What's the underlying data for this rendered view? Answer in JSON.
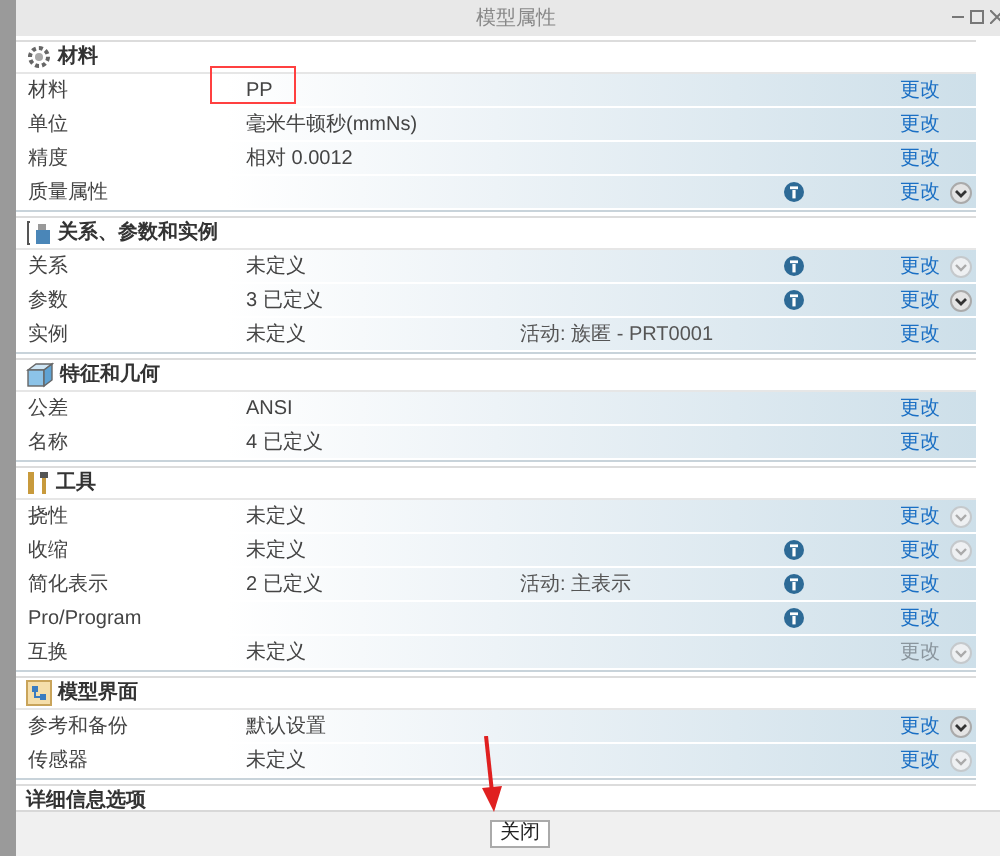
{
  "window": {
    "title": "模型属性"
  },
  "sections": [
    {
      "kind": "material",
      "title": "材料",
      "rows": [
        {
          "label": "材料",
          "value": "PP",
          "highlighted": true,
          "info": false,
          "change": {
            "label": "更改",
            "disabled": false
          }
        },
        {
          "label": "单位",
          "value": "毫米牛顿秒(mmNs)",
          "highlighted": false,
          "info": false,
          "change": {
            "label": "更改",
            "disabled": false
          }
        },
        {
          "label": "精度",
          "value": "相对 0.0012",
          "highlighted": false,
          "info": false,
          "change": {
            "label": "更改",
            "disabled": false
          }
        },
        {
          "label": "质量属性",
          "highlighted": false,
          "info": true,
          "change": {
            "label": "更改",
            "disabled": false
          },
          "expander": {
            "disabled": false
          }
        }
      ]
    },
    {
      "kind": "relations",
      "title": "关系、参数和实例",
      "rows": [
        {
          "label": "关系",
          "value": "未定义",
          "highlighted": false,
          "info": true,
          "change": {
            "label": "更改",
            "disabled": false
          },
          "expander": {
            "disabled": true
          }
        },
        {
          "label": "参数",
          "value": "3 已定义",
          "highlighted": false,
          "info": true,
          "change": {
            "label": "更改",
            "disabled": false
          },
          "expander": {
            "disabled": false
          }
        },
        {
          "label": "实例",
          "value": "未定义",
          "extra": "活动: 族匿 - PRT0001",
          "highlighted": false,
          "info": false,
          "change": {
            "label": "更改",
            "disabled": false
          }
        }
      ]
    },
    {
      "kind": "features",
      "title": "特征和几何",
      "rows": [
        {
          "label": "公差",
          "value": "ANSI",
          "highlighted": false,
          "info": false,
          "change": {
            "label": "更改",
            "disabled": false
          }
        },
        {
          "label": "名称",
          "value": "4 已定义",
          "highlighted": false,
          "info": false,
          "change": {
            "label": "更改",
            "disabled": false
          }
        }
      ]
    },
    {
      "kind": "tools",
      "title": "工具",
      "rows": [
        {
          "label": "挠性",
          "value": "未定义",
          "highlighted": false,
          "info": false,
          "change": {
            "label": "更改",
            "disabled": false
          },
          "expander": {
            "disabled": true
          }
        },
        {
          "label": "收缩",
          "value": "未定义",
          "highlighted": false,
          "info": true,
          "change": {
            "label": "更改",
            "disabled": false
          },
          "expander": {
            "disabled": true
          }
        },
        {
          "label": "简化表示",
          "value": "2 已定义",
          "extra": "活动: 主表示",
          "highlighted": false,
          "info": true,
          "change": {
            "label": "更改",
            "disabled": false
          }
        },
        {
          "label": "Pro/Program",
          "highlighted": false,
          "info": true,
          "change": {
            "label": "更改",
            "disabled": false
          }
        },
        {
          "label": "互换",
          "value": "未定义",
          "highlighted": false,
          "info": false,
          "change": {
            "label": "更改",
            "disabled": true
          },
          "expander": {
            "disabled": true
          }
        }
      ]
    },
    {
      "kind": "interface",
      "title": "模型界面",
      "rows": [
        {
          "label": "参考和备份",
          "value": "默认设置",
          "highlighted": false,
          "info": false,
          "change": {
            "label": "更改",
            "disabled": false
          },
          "expander": {
            "disabled": false
          }
        },
        {
          "label": "传感器",
          "value": "未定义",
          "highlighted": false,
          "info": false,
          "change": {
            "label": "更改",
            "disabled": false
          },
          "expander": {
            "disabled": true
          }
        }
      ]
    },
    {
      "kind": "details",
      "title": "详细信息选项"
    }
  ],
  "close_button": "关闭",
  "annotation_arrow": true
}
